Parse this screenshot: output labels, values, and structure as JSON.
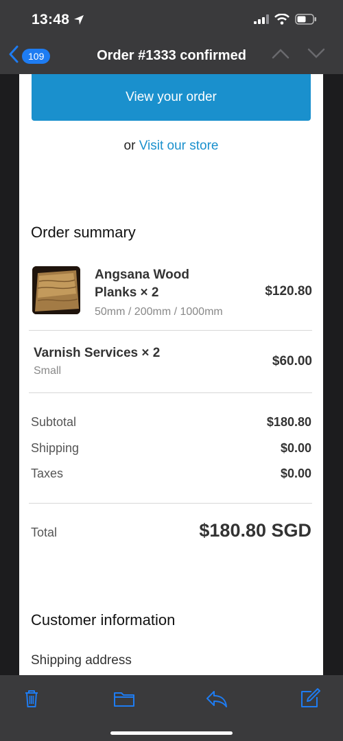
{
  "status_bar": {
    "time": "13:48"
  },
  "nav": {
    "badge_count": "109",
    "title": "Order #1333 confirmed"
  },
  "email": {
    "view_order_label": "View your order",
    "visit_prefix": "or",
    "visit_link": "Visit our store",
    "summary_heading": "Order summary",
    "items": [
      {
        "name_line1": "Angsana Wood",
        "name_line2": "Planks × 2",
        "variant": "50mm / 200mm / 1000mm",
        "price": "$120.80"
      },
      {
        "name_line1": "Varnish Services × 2",
        "variant": "Small",
        "price": "$60.00"
      }
    ],
    "summary": [
      {
        "label": "Subtotal",
        "value": "$180.80"
      },
      {
        "label": "Shipping",
        "value": "$0.00"
      },
      {
        "label": "Taxes",
        "value": "$0.00"
      }
    ],
    "total": {
      "label": "Total",
      "value": "$180.80 SGD"
    },
    "customer_heading": "Customer information",
    "shipping_address_label": "Shipping address"
  },
  "toolbar": {
    "icons": [
      "trash-icon",
      "folder-icon",
      "reply-icon",
      "compose-icon"
    ]
  },
  "colors": {
    "accent": "#1a90cd",
    "ios_blue": "#1e7cf2",
    "bar_bg": "#3a3a3c"
  }
}
